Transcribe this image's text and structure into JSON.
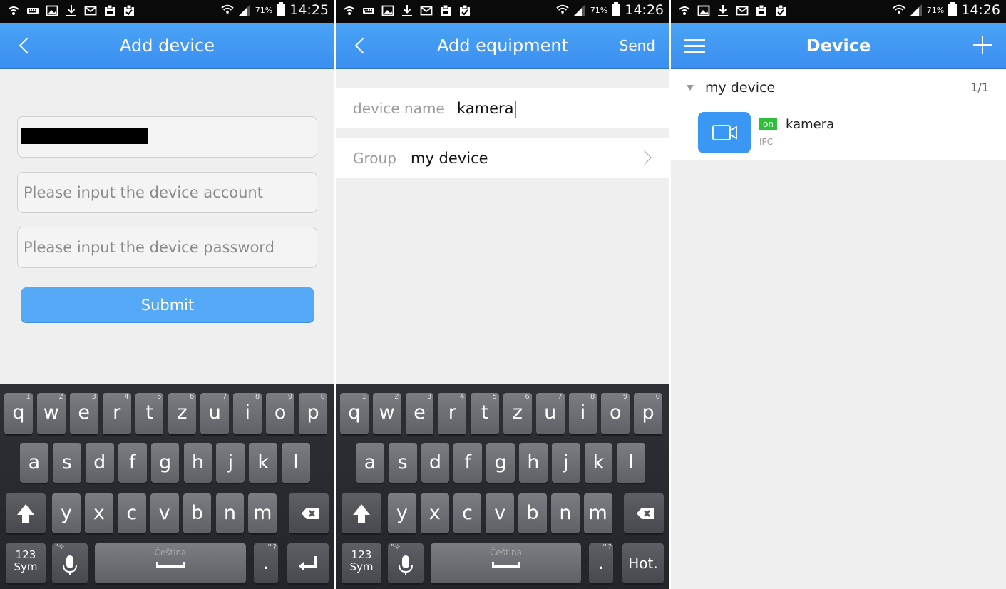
{
  "screens": [
    {
      "status": {
        "battery": "71%",
        "time": "14:25"
      },
      "title": "Add device",
      "fields": {
        "account_placeholder": "Please input the device account",
        "password_placeholder": "Please input the device password"
      },
      "submit_label": "Submit"
    },
    {
      "status": {
        "battery": "71%",
        "time": "14:26"
      },
      "title": "Add equipment",
      "send_label": "Send",
      "device_name_label": "device name",
      "device_name_value": "kamera",
      "group_label": "Group",
      "group_value": "my device"
    },
    {
      "status": {
        "battery": "71%",
        "time": "14:26"
      },
      "title": "Device",
      "group": {
        "name": "my device",
        "count": "1/1"
      },
      "device": {
        "status": "on",
        "name": "kamera",
        "type": "IPC"
      }
    }
  ],
  "keyboard": {
    "row1": [
      "q",
      "w",
      "e",
      "r",
      "t",
      "z",
      "u",
      "i",
      "o",
      "p"
    ],
    "row1_hints": [
      "1",
      "2",
      "3",
      "4",
      "5",
      "6",
      "7",
      "8",
      "9",
      "0"
    ],
    "row2": [
      "a",
      "s",
      "d",
      "f",
      "g",
      "h",
      "j",
      "k",
      "l"
    ],
    "row3": [
      "y",
      "x",
      "c",
      "v",
      "b",
      "n",
      "m"
    ],
    "sym_top": "123",
    "sym_bottom": "Sym",
    "language": "Čeština",
    "period": ".",
    "period_hint": "'\"?",
    "mic_hint": "\"☼",
    "hot_label": "Hot."
  },
  "colors": {
    "accent": "#3a8ff0",
    "online": "#2fc03a"
  }
}
